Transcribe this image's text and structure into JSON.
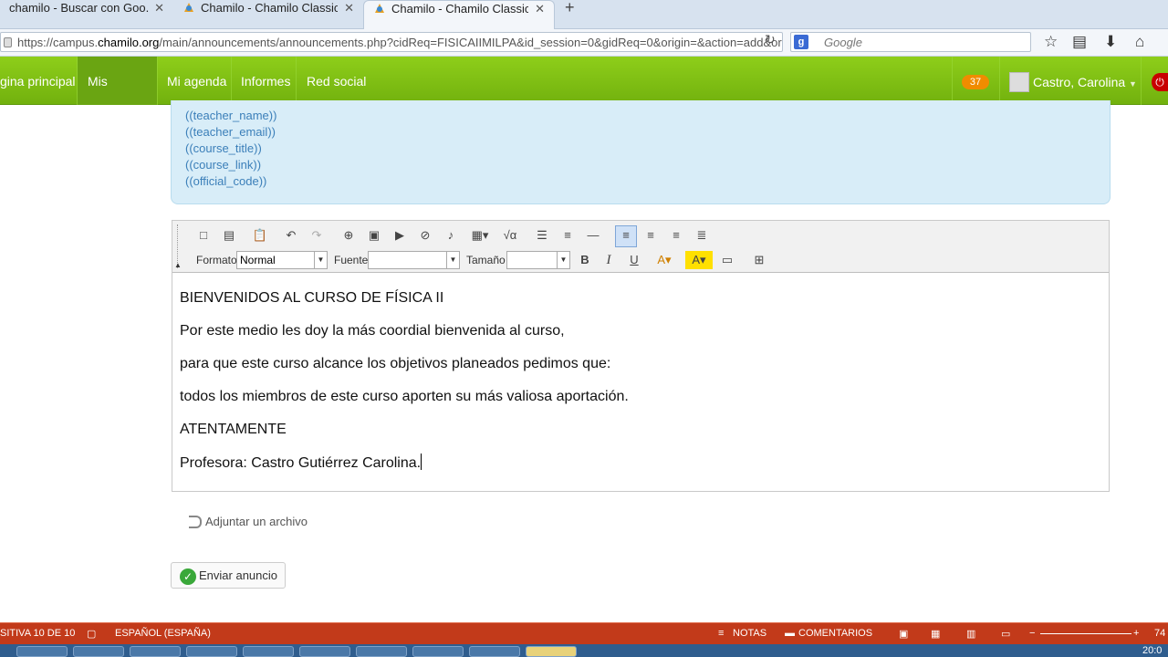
{
  "browser": {
    "tabs": [
      {
        "title": "chamilo - Buscar con Goo..."
      },
      {
        "title": "Chamilo - Chamilo Classic ..."
      },
      {
        "title": "Chamilo - Chamilo Classic ..."
      }
    ],
    "url_prefix": "https://campus.",
    "url_domain": "chamilo.org",
    "url_rest": "/main/announcements/announcements.php?cidReq=FISICAIIMILPA&id_session=0&gidReq=0&origin=&action=add&orig",
    "search_placeholder": "Google"
  },
  "nav": {
    "items": [
      "gina principal",
      "Mis cursos",
      "Mi agenda",
      "Informes",
      "Red social"
    ],
    "active": "Mis cursos",
    "notifications": "37",
    "user": "Castro, Carolina"
  },
  "tags": [
    "((teacher_name))",
    "((teacher_email))",
    "((course_title))",
    "((course_link))",
    "((official_code))"
  ],
  "toolbar": {
    "format_label": "Formato",
    "format_value": "Normal",
    "font_label": "Fuente",
    "font_value": "",
    "size_label": "Tamaño",
    "size_value": ""
  },
  "content": [
    "BIENVENIDOS AL CURSO DE FÍSICA II",
    "Por este medio les doy la más coordial bienvenida al curso,",
    "para que este curso alcance los objetivos planeados pedimos que:",
    "todos los miembros de este curso aporten su más valiosa aportación.",
    "ATENTAMENTE",
    "Profesora: Castro Gutiérrez Carolina."
  ],
  "attach_label": "Adjuntar un archivo",
  "send_label": "Enviar anuncio",
  "statusbar": {
    "slide": "SITIVA 10 DE 10",
    "language": "ESPAÑOL (ESPAÑA)",
    "notes": "NOTAS",
    "comments": "COMENTARIOS",
    "zoom": "74"
  },
  "clock": "20:0"
}
